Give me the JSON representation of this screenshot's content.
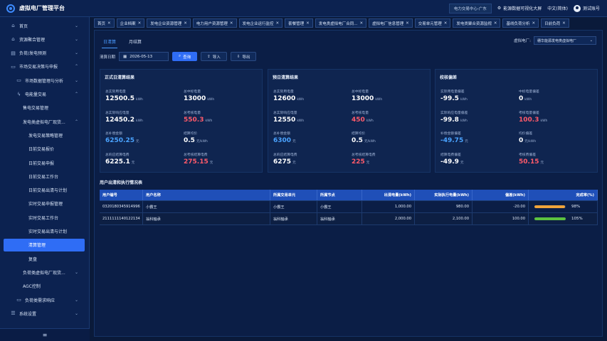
{
  "app": {
    "title": "虚拟电厂管理平台"
  },
  "topbar": {
    "center": "电力交易中心-广东",
    "energy": "能源数据可视化大屏",
    "lang": "中文(简体)",
    "user": "测试账号"
  },
  "sidebar": {
    "items": [
      {
        "label": "首页",
        "icon": "home-icon",
        "level": 0,
        "chevron": "⌄"
      },
      {
        "label": "资源聚合管理",
        "icon": "home-icon",
        "level": 0,
        "chevron": "⌄"
      },
      {
        "label": "负荷/发电预测",
        "icon": "chart-icon",
        "level": 0,
        "chevron": "⌄"
      },
      {
        "label": "市场交易决策与申报",
        "icon": "monitor-icon",
        "level": 0,
        "chevron": "⌃"
      },
      {
        "label": "市场数据管理与分析",
        "icon": "monitor-icon",
        "level": 1,
        "chevron": "⌄"
      },
      {
        "label": "电能量交易",
        "icon": "bolt-icon",
        "level": 1,
        "chevron": "⌃"
      },
      {
        "label": "售电交易管理",
        "icon": "",
        "level": 2,
        "chevron": ""
      },
      {
        "label": "发电类虚拟电厂现货...",
        "icon": "",
        "level": 2,
        "chevron": "⌃"
      },
      {
        "label": "发电交易策略管理",
        "icon": "",
        "level": 3,
        "chevron": ""
      },
      {
        "label": "日前交易报价",
        "icon": "",
        "level": 3,
        "chevron": ""
      },
      {
        "label": "日前交易申报",
        "icon": "",
        "level": 3,
        "chevron": ""
      },
      {
        "label": "日前交易工作台",
        "icon": "",
        "level": 3,
        "chevron": ""
      },
      {
        "label": "日前交易出清与计划",
        "icon": "",
        "level": 3,
        "chevron": ""
      },
      {
        "label": "实时交易申报管理",
        "icon": "",
        "level": 3,
        "chevron": ""
      },
      {
        "label": "实时交易工作台",
        "icon": "",
        "level": 3,
        "chevron": ""
      },
      {
        "label": "实时交易出清与计划",
        "icon": "",
        "level": 3,
        "chevron": ""
      },
      {
        "label": "清算管理",
        "icon": "",
        "level": 3,
        "chevron": "",
        "active": true
      },
      {
        "label": "复盘",
        "icon": "",
        "level": 3,
        "chevron": ""
      },
      {
        "label": "负荷类虚拟电厂现货...",
        "icon": "",
        "level": 2,
        "chevron": "⌄"
      },
      {
        "label": "AGC控制",
        "icon": "",
        "level": 2,
        "chevron": ""
      },
      {
        "label": "负荷类需求响应",
        "icon": "monitor-icon",
        "level": 1,
        "chevron": "⌄"
      },
      {
        "label": "系统设置",
        "icon": "sliders-icon",
        "level": 0,
        "chevron": "⌄"
      }
    ],
    "footer": "≡"
  },
  "tabs": [
    {
      "label": "首页"
    },
    {
      "label": "企业档案"
    },
    {
      "label": "发电企业资源管理"
    },
    {
      "label": "电力用户资源管理"
    },
    {
      "label": "发电企业运行监控"
    },
    {
      "label": "套餐管理"
    },
    {
      "label": "发电类虚拟电厂合同..."
    },
    {
      "label": "虚拟电厂信息管理"
    },
    {
      "label": "交易单元管理"
    },
    {
      "label": "发电类聚合资源监视"
    },
    {
      "label": "基线负荷分析"
    },
    {
      "label": "日前负荷"
    }
  ],
  "subtabs": [
    "日清算",
    "月结算"
  ],
  "plant": {
    "label": "虚拟电厂:",
    "value": "穗华能源发电类虚拟电厂"
  },
  "filter": {
    "label": "清算日期",
    "date": "2026-05-13",
    "query": "查询",
    "import": "导入",
    "export": "导出"
  },
  "cards": [
    {
      "title": "正式日清算结果",
      "stats": [
        {
          "label": "总实际用电量",
          "value": "12500.5",
          "unit": "kWh",
          "color": "white"
        },
        {
          "label": "总中标电量",
          "value": "13000",
          "unit": "kWh",
          "color": "white"
        },
        {
          "label": "总实际响应电量",
          "value": "12450.2",
          "unit": "kWh",
          "color": "white"
        },
        {
          "label": "总考核电量",
          "value": "550.3",
          "unit": "kWh",
          "color": "red"
        },
        {
          "label": "总补偿金额",
          "value": "6250.25",
          "unit": "元",
          "color": "blue"
        },
        {
          "label": "结算均价",
          "value": "0.5",
          "unit": "元/kWh",
          "color": "white"
        },
        {
          "label": "总响应结算电费",
          "value": "6225.1",
          "unit": "元",
          "color": "white"
        },
        {
          "label": "总考核结算电费",
          "value": "275.15",
          "unit": "元",
          "color": "red"
        }
      ]
    },
    {
      "title": "预日清算结果",
      "stats": [
        {
          "label": "总实际用电量",
          "value": "12600",
          "unit": "kWh",
          "color": "white"
        },
        {
          "label": "总中标电量",
          "value": "13000",
          "unit": "kWh",
          "color": "white"
        },
        {
          "label": "总实际响应电量",
          "value": "12550",
          "unit": "kWh",
          "color": "white"
        },
        {
          "label": "总考核电量",
          "value": "450",
          "unit": "kWh",
          "color": "red"
        },
        {
          "label": "总补偿金额",
          "value": "6300",
          "unit": "元",
          "color": "blue"
        },
        {
          "label": "结算均价",
          "value": "0.5",
          "unit": "元/kWh",
          "color": "white"
        },
        {
          "label": "总响应结算电费",
          "value": "6275",
          "unit": "元",
          "color": "white"
        },
        {
          "label": "总考核结算电费",
          "value": "225",
          "unit": "元",
          "color": "red"
        }
      ]
    },
    {
      "title": "校核偏差",
      "stats": [
        {
          "label": "实际用电量偏差",
          "value": "-99.5",
          "unit": "kWh",
          "color": "white"
        },
        {
          "label": "中标电量偏差",
          "value": "0",
          "unit": "kWh",
          "color": "white"
        },
        {
          "label": "实际响应电量偏差",
          "value": "-99.8",
          "unit": "kWh",
          "color": "white"
        },
        {
          "label": "考核电量偏差",
          "value": "100.3",
          "unit": "kWh",
          "color": "red"
        },
        {
          "label": "补偿金额偏差",
          "value": "-49.75",
          "unit": "元",
          "color": "blue"
        },
        {
          "label": "均价偏差",
          "value": "0",
          "unit": "元/kWh",
          "color": "white"
        },
        {
          "label": "结算电费偏差",
          "value": "-49.9",
          "unit": "元",
          "color": "white"
        },
        {
          "label": "考核费偏差",
          "value": "50.15",
          "unit": "元",
          "color": "red"
        }
      ]
    }
  ],
  "table": {
    "title": "用户出清和执行情况表",
    "headers": [
      "用户编号",
      "用户名称",
      "所属交易单元",
      "所属节点",
      "出清电量(kWh)",
      "实际执行电量(kWh)",
      "偏差(kWh)",
      "完成率(%)"
    ],
    "rows": [
      {
        "cells": [
          "0320180345914996",
          "小霸王",
          "小霸王",
          "小霸王",
          "1,000.00",
          "980.00",
          "-20.00"
        ],
        "pct_label": "98%",
        "pct": 0.98,
        "color": "#f0a43a"
      },
      {
        "cells": [
          "2111111140122134",
          "翁科轴承",
          "翁科轴承",
          "翁科轴承",
          "2,000.00",
          "2,100.00",
          "100.00"
        ],
        "pct_label": "105%",
        "pct": 1.0,
        "color": "#5cc23f"
      }
    ]
  }
}
